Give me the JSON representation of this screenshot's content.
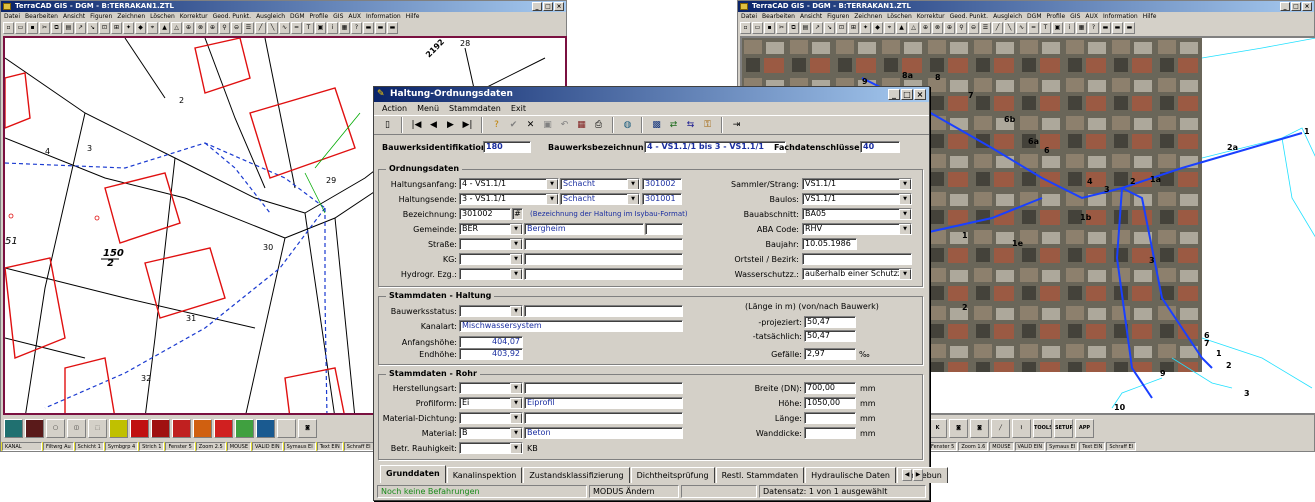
{
  "cad_left": {
    "title": "TerraCAD GIS - DGM - B:TERRAKAN1.ZTL",
    "menu": [
      "Datei",
      "Bearbeiten",
      "Ansicht",
      "Figuren",
      "Zeichnen",
      "Löschen",
      "Korrektur",
      "Geod. Punkt.",
      "Ausgleich",
      "DGM",
      "Profile",
      "GIS",
      "AUX",
      "Information",
      "Hilfe"
    ],
    "map_labels": {
      "n2192": "2192",
      "n28": "28",
      "n2": "2",
      "n29": "29",
      "n30": "30",
      "n31": "31",
      "n32": "32",
      "n3": "3",
      "n4": "4",
      "n51": "51",
      "n150": "150",
      "n150b": "2"
    },
    "status": [
      "KANAL",
      "Filtwrg Au",
      "Schicht 1",
      "Symbgrp 4",
      "Strich 1",
      "Fenster 5",
      "Zoom 2.5",
      "MOUSE",
      "VALID EIN",
      "Symaus EI",
      "Text EIN",
      "Schraff EI"
    ]
  },
  "cad_right": {
    "title": "TerraCAD GIS - DGM - B:TERRAKAN1.ZTL",
    "menu": [
      "Datei",
      "Bearbeiten",
      "Ansicht",
      "Figuren",
      "Zeichnen",
      "Löschen",
      "Korrektur",
      "Geod. Punkt.",
      "Ausgleich",
      "DGM",
      "Profile",
      "GIS",
      "AUX",
      "Information",
      "Hilfe"
    ],
    "map_labels": {
      "n9": "9",
      "n8a": "8a",
      "n8": "8",
      "n7": "7",
      "n6b": "6b",
      "n6a": "6a",
      "n6": "6",
      "n4": "4",
      "n3": "3",
      "n2": "2",
      "n1a": "1a",
      "n1b": "1b",
      "n1": "1",
      "n2a": "2a",
      "n1r": "1",
      "n3b": "3",
      "n2c": "2",
      "n1e": "1e",
      "n6c": "6",
      "n7c": "7",
      "n1d": "1",
      "n2d": "2",
      "n3d": "3",
      "n9d": "9",
      "n10": "10"
    },
    "status": [
      "Fenster 5",
      "Zoom 1.6",
      "MOUSE",
      "VALID EIN",
      "Symaus EI",
      "Text EIN",
      "Schraff EI"
    ]
  },
  "dialog": {
    "title": "Haltung-Ordnungsdaten",
    "menu": [
      "Action",
      "Menü",
      "Stammdaten",
      "Exit"
    ],
    "header": {
      "bw_id_label": "Bauwerksidentifikation:",
      "bw_id_value": "180",
      "bw_name_label": "Bauwerksbezeichnung:",
      "bw_name_value": "4 - VS1.1/1 bis 3 - VS1.1/1",
      "fach_label": "Fachdatenschlüssel:",
      "fach_value": "40"
    },
    "ordnung": {
      "title": "Ordnungsdaten",
      "anfang_label": "Haltungsanfang:",
      "anfang_value": "4 - VS1.1/1",
      "anfang_type": "Schacht",
      "anfang_no": "301002",
      "ende_label": "Haltungsende:",
      "ende_value": "3 - VS1.1/1",
      "ende_type": "Schacht",
      "ende_no": "301001",
      "bez_label": "Bezeichnung:",
      "bez_value": "301002",
      "bez_btn": "#",
      "bez_hint": "(Bezeichnung der Haltung im Isybau-Format)",
      "gemeinde_label": "Gemeinde:",
      "gemeinde_value": "BER",
      "gemeinde_name": "Bergheim",
      "strasse_label": "Straße:",
      "kg_label": "KG:",
      "hydro_label": "Hydrogr. Ezg.:",
      "sammler_label": "Sammler/Strang:",
      "sammler_value": "VS1.1/1",
      "baulos_label": "Baulos:",
      "baulos_value": "VS1.1/1",
      "bauabschnitt_label": "Bauabschnitt:",
      "bauabschnitt_value": "BA05",
      "aba_label": "ABA Code:",
      "aba_value": "RHV",
      "baujahr_label": "Baujahr:",
      "baujahr_value": "10.05.1986",
      "ortsteil_label": "Ortsteil / Bezirk:",
      "wasser_label": "Wasserschutzz.:",
      "wasser_value": "außerhalb einer Schutzzone"
    },
    "haltung": {
      "title": "Stammdaten - Haltung",
      "status_label": "Bauwerksstatus:",
      "kanalart_label": "Kanalart:",
      "kanalart_value": "Mischwassersystem",
      "anfangshoehe_label": "Anfangshöhe:",
      "anfangshoehe_value": "404,07",
      "endhoehe_label": "Endhöhe:",
      "endhoehe_value": "403,92",
      "laenge_hint": "(Länge in m) (von/nach Bauwerk)",
      "proj_label": "-projeziert:",
      "proj_value": "50,47",
      "tats_label": "-tatsächlich:",
      "tats_value": "50,47",
      "gefaelle_label": "Gefälle:",
      "gefaelle_value": "2,97",
      "gefaelle_unit": "‰"
    },
    "rohr": {
      "title": "Stammdaten - Rohr",
      "herst_label": "Herstellungsart:",
      "profil_label": "Profilform:",
      "profil_value": "Ei",
      "profil_name": "Eiprofil",
      "dichtung_label": "Material-Dichtung:",
      "material_label": "Material:",
      "material_value": "B",
      "material_name": "Beton",
      "rauh_label": "Betr. Rauhigkeit:",
      "rauh_unit": "KB",
      "breite_label": "Breite (DN):",
      "breite_value": "700,00",
      "hoehe_label": "Höhe:",
      "hoehe_value": "1050,00",
      "laenge_label": "Länge:",
      "wand_label": "Wanddicke:",
      "unit_mm": "mm"
    },
    "tabs": [
      "Grunddaten",
      "Kanalinspektion",
      "Zustandsklassifizierung",
      "Dichtheitsprüfung",
      "Restl. Stammdaten",
      "Hydraulische Daten",
      "Umgebun"
    ],
    "statusbar": {
      "left": "Noch keine Befahrungen",
      "mode": "MODUS Ändern",
      "record": "Datensatz: 1 von 1 ausgewählt"
    }
  }
}
